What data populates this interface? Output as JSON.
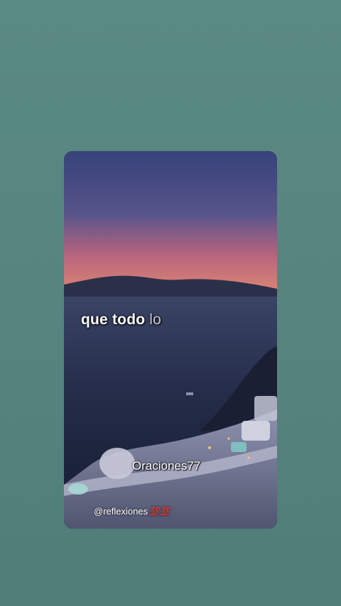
{
  "video": {
    "caption_main": "que todo",
    "caption_next": "lo",
    "watermark": "Oraciones77",
    "handle": "@reflexiones",
    "handle_emoji": [
      "💯",
      "💯"
    ]
  },
  "colors": {
    "background": "#56847e",
    "sky_top": "#3b4a7a",
    "sky_sunset": "#d46a7a",
    "sea": "#232c47",
    "emoji_red": "#e8233b"
  }
}
